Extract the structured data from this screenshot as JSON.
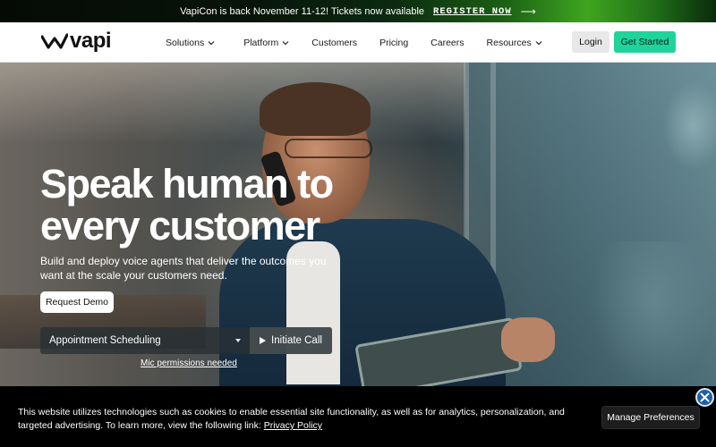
{
  "announcement": {
    "message": "VapiCon is back November 11-12! Tickets now available",
    "cta": "REGISTER NOW",
    "arrow_icon": "arrow-right-icon"
  },
  "nav": {
    "logo_text": "vapi",
    "items": [
      {
        "label": "Solutions",
        "has_dropdown": true
      },
      {
        "label": "Platform",
        "has_dropdown": true
      },
      {
        "label": "Customers",
        "has_dropdown": false
      },
      {
        "label": "Pricing",
        "has_dropdown": false
      },
      {
        "label": "Careers",
        "has_dropdown": false
      },
      {
        "label": "Resources",
        "has_dropdown": true
      }
    ],
    "login_label": "Login",
    "cta_label": "Get Started",
    "cta_color": "#1fd39a"
  },
  "hero": {
    "headline": "Speak human to every customer",
    "subtext": "Build and deploy voice agents that deliver the outcomes you want at the scale your customers need.",
    "demo_label": "Request Demo",
    "selected_scenario": "Appointment Scheduling",
    "call_label": "Initiate Call",
    "mic_note": "Mic permissions needed"
  },
  "cookie_banner": {
    "text": "This website utilizes technologies such as cookies to enable essential site functionality, as well as for analytics, personalization, and targeted advertising. To learn more, view the following link:",
    "link_label": "Privacy Policy",
    "manage_label": "Manage Preferences",
    "close_icon": "close-icon"
  }
}
